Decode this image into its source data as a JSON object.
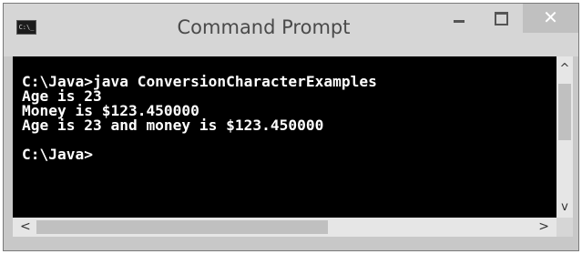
{
  "window": {
    "title": "Command Prompt",
    "icon": "C:\\_",
    "controls": {
      "minimize": "minimize-icon",
      "maximize": "maximize-icon",
      "close": "✕"
    }
  },
  "console": {
    "text": "C:\\Java>java ConversionCharacterExamples\nAge is 23\nMoney is $123.450000\nAge is 23 and money is $123.450000\n\nC:\\Java>"
  },
  "scrollbars": {
    "up": "^",
    "down": "v",
    "left": "<",
    "right": ">"
  }
}
